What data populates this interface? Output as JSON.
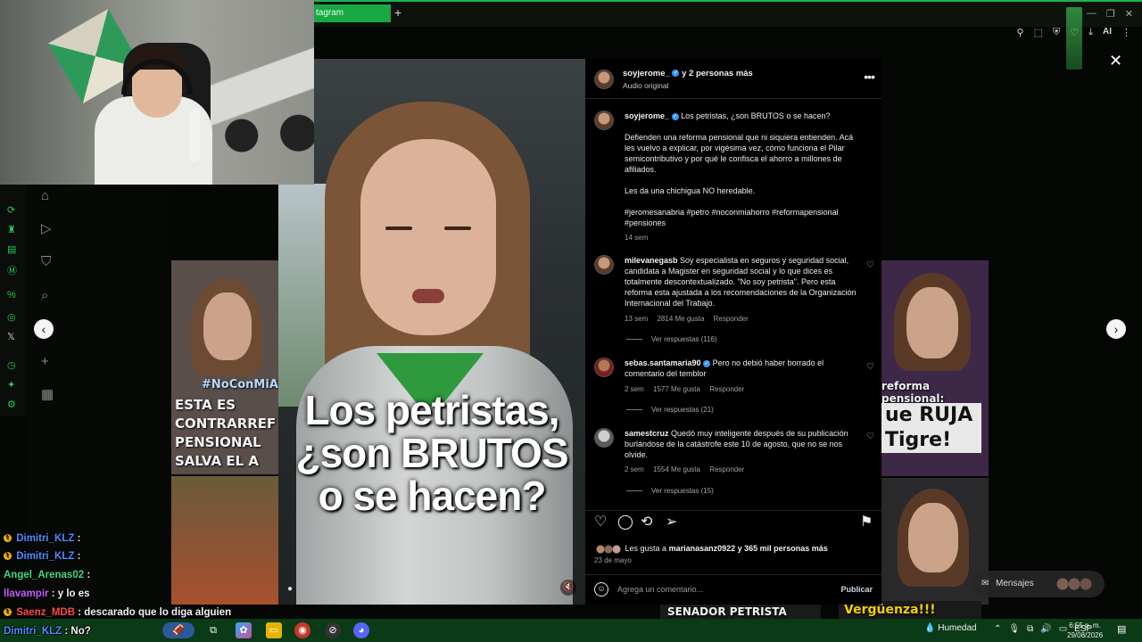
{
  "browser": {
    "tab_label": "tagram",
    "new_tab": "+",
    "window_controls": [
      "—",
      "❐",
      "✕"
    ],
    "toolbar_ai": "AI"
  },
  "chat": [
    {
      "user": "Dimitri_KLZ",
      "user_color": "#4e8cff",
      "msg": ""
    },
    {
      "user": "Dimitri_KLZ",
      "user_color": "#4e8cff",
      "msg": ""
    },
    {
      "user": "Angel_Arenas02",
      "user_color": "#3ddc84",
      "msg": ""
    },
    {
      "user": "llavampir",
      "user_color": "#c45cff",
      "msg": "y lo es"
    },
    {
      "user": "Saenz_MDB",
      "user_color": "#ff4b4b",
      "msg": "descarado que lo diga alguien"
    },
    {
      "user": "Dimitri_KLZ",
      "user_color": "#4e8cff",
      "msg": "No?"
    }
  ],
  "background_thumbs": {
    "left_top_text": "#NoConMiAh",
    "left_main_text": "ESTA ES CONTRARREF PENSIONAL SALVA EL A",
    "right_top_text": "reforma pensional:",
    "right_main_text": "ue RUJA Tigre!",
    "bottom_center_text": "SENADOR PETRISTA",
    "bottom_right_text": "Vergüenza!!!"
  },
  "video": {
    "caption": "Los petristas, ¿son BRUTOS o se hacen?",
    "mute_icon": "volume-muted-icon"
  },
  "post": {
    "header": {
      "username": "soyjerome_",
      "others": "y 2 personas más",
      "audio": "Audio original"
    },
    "caption": {
      "username": "soyjerome_",
      "title": "Los petristas, ¿son BRUTOS o se hacen?",
      "body1": "Defienden una reforma pensional que ni siquiera entienden. Acá les vuelvo a explicar, por vigésima vez, cómo funciona el Pilar semicontributivo y por qué le confisca el ahorro a millones de afiliados.",
      "body2": "Les da una chichigua NO heredable.",
      "hashtags": "#jeromesanabria #petro #noconmiahorro #reformapensional #pensiones",
      "time": "14 sem"
    },
    "comments": [
      {
        "username": "milevanegasb",
        "text": "Soy especialista en seguros y seguridad social, candidata a Magister en seguridad social y lo que dices es totalmente descontextualizado. \"No soy petrista\". Pero esta reforma esta ajustada a los recomendaciones de la Organización Internacional del Trabajo.",
        "time": "13 sem",
        "likes": "2814 Me gusta",
        "reply": "Responder",
        "view_replies": "Ver respuestas (116)"
      },
      {
        "username": "sebas.santamaria90",
        "text": "Pero no debió haber borrado el comentario del temblor",
        "time": "2 sem",
        "likes": "1577 Me gusta",
        "reply": "Responder",
        "view_replies": "Ver respuestas (21)"
      },
      {
        "username": "samestcruz",
        "text": "Quedó muy inteligente después de su publicación burlándose de la catástrofe este 10 de agosto, que no se nos olvide.",
        "time": "2 sem",
        "likes": "1554 Me gusta",
        "reply": "Responder",
        "view_replies": "Ver respuestas (15)"
      }
    ],
    "likes_prefix": "Les gusta a",
    "likes_user": "marianasanz0922",
    "likes_suffix": "y 365 mil personas más",
    "date": "23 de mayo",
    "comment_placeholder": "Agrega un comentario...",
    "publish": "Publicar"
  },
  "messages_pill": {
    "label": "Mensajes"
  },
  "taskbar": {
    "weather": "Humedad",
    "lang": "ESP",
    "time": "6:55 p. m.",
    "date": "29/08/2026"
  }
}
